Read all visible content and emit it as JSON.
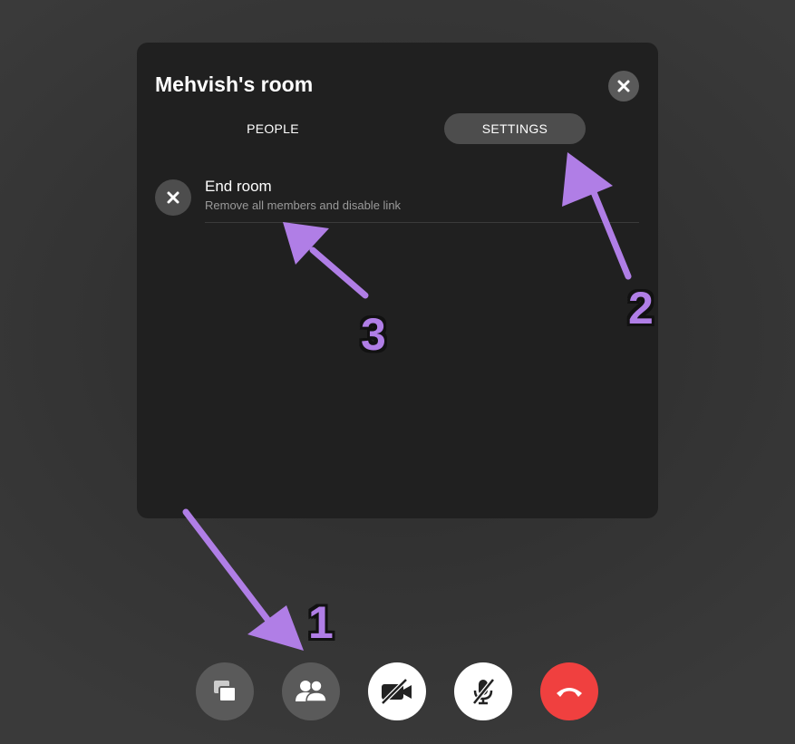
{
  "room": {
    "title": "Mehvish's room",
    "tabs": [
      {
        "label": "PEOPLE",
        "active": false
      },
      {
        "label": "SETTINGS",
        "active": true
      }
    ],
    "end_room": {
      "title": "End room",
      "subtitle": "Remove all members and disable link"
    }
  },
  "toolbar": {
    "buttons": [
      {
        "icon": "screen-share-icon"
      },
      {
        "icon": "people-icon"
      },
      {
        "icon": "video-off-icon"
      },
      {
        "icon": "mic-off-icon"
      },
      {
        "icon": "end-call-icon"
      }
    ]
  },
  "annotations": {
    "labels": [
      "1",
      "2",
      "3"
    ],
    "arrow_color": "#b07ee6"
  },
  "colors": {
    "panel": "#202020",
    "end_call": "#f0403f",
    "active_tab": "#4d4d4d"
  }
}
